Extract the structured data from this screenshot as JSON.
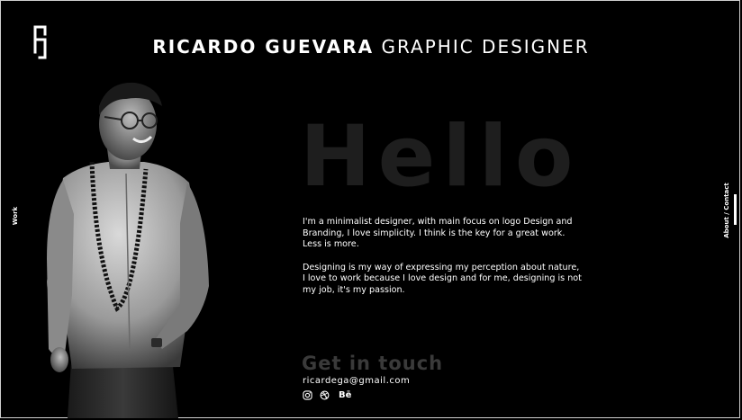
{
  "header": {
    "name": "RICARDO GUEVARA",
    "role": "GRAPHIC DESIGNER",
    "logo_icon": "rg-monogram-icon"
  },
  "nav": {
    "left_label": "Work",
    "right_label": "About / Contact"
  },
  "hero": {
    "headline": "Hello",
    "paragraph_1": "I'm a minimalist designer, with main focus on logo Design and Branding, I love simplicity. I think is the key for a great work. Less is more.",
    "paragraph_2": "Designing is my way of expressing my perception about nature, I love to work because I love design and for me, designing is not my job, it's my passion."
  },
  "contact": {
    "heading": "Get in touch",
    "email": "ricardega@gmail.com",
    "socials": [
      {
        "icon": "instagram-icon"
      },
      {
        "icon": "dribbble-icon"
      },
      {
        "icon": "behance-icon",
        "label": "Bē"
      }
    ]
  },
  "colors": {
    "background": "#000000",
    "text": "#ffffff",
    "headline_muted": "#1e1e1e",
    "contact_muted": "#3a3a3a"
  }
}
